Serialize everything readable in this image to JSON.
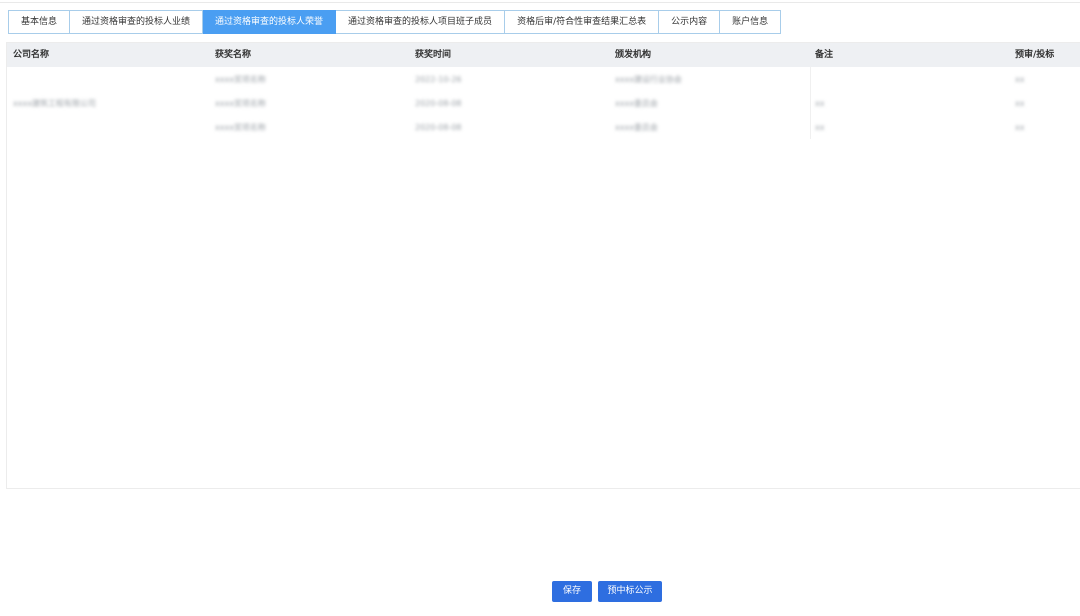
{
  "tabs": [
    {
      "label": "基本信息",
      "active": false
    },
    {
      "label": "通过资格审查的投标人业绩",
      "active": false
    },
    {
      "label": "通过资格审查的投标人荣誉",
      "active": true
    },
    {
      "label": "通过资格审查的投标人项目班子成员",
      "active": false
    },
    {
      "label": "资格后审/符合性审查结果汇总表",
      "active": false
    },
    {
      "label": "公示内容",
      "active": false
    },
    {
      "label": "账户信息",
      "active": false
    }
  ],
  "table": {
    "columns": [
      "公司名称",
      "获奖名称",
      "获奖时间",
      "颁发机构",
      "备注",
      "预审/投标"
    ],
    "rows": [
      [
        "",
        "xxxx奖项名称",
        "2022-10-26",
        "xxxx建设行业协会",
        "",
        "xx"
      ],
      [
        "xxxx建筑工程有限公司",
        "xxxx奖项名称",
        "2020-08-08",
        "xxxx委员会",
        "xx",
        "xx"
      ],
      [
        "",
        "xxxx奖项名称",
        "2020-08-08",
        "xxxx委员会",
        "xx",
        "xx"
      ]
    ]
  },
  "buttons": {
    "save": "保存",
    "pre_award": "预中标公示"
  }
}
